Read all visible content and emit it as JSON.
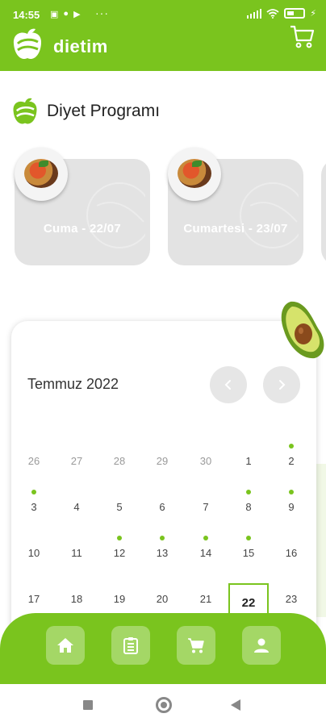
{
  "status_bar": {
    "time": "14:55",
    "icons": [
      "sim-icon",
      "whatsapp-icon",
      "play-icon",
      "more-dots"
    ],
    "battery_icon": "battery-icon",
    "wifi_icon": "wifi-icon",
    "signal_icon": "signal-icon"
  },
  "app_bar": {
    "brand": "dietim",
    "logo_icon": "apple-logo-icon",
    "cart_icon": "cart-icon"
  },
  "section": {
    "title": "Diyet Programı",
    "icon": "apple-logo-icon"
  },
  "day_cards": [
    {
      "label": "Cuma - 22/07",
      "image": "food-plate"
    },
    {
      "label": "Cumartesi - 23/07",
      "image": "food-plate"
    }
  ],
  "calendar": {
    "month_label": "Temmuz 2022",
    "prev_icon": "chevron-left-icon",
    "next_icon": "chevron-right-icon",
    "weeks": [
      [
        {
          "day": "26",
          "muted": true,
          "dot": false
        },
        {
          "day": "27",
          "muted": true,
          "dot": false
        },
        {
          "day": "28",
          "muted": true,
          "dot": false
        },
        {
          "day": "29",
          "muted": true,
          "dot": false
        },
        {
          "day": "30",
          "muted": true,
          "dot": false
        },
        {
          "day": "1",
          "muted": false,
          "dot": false
        },
        {
          "day": "2",
          "muted": false,
          "dot": true
        }
      ],
      [
        {
          "day": "3",
          "muted": false,
          "dot": true
        },
        {
          "day": "4",
          "muted": false,
          "dot": false
        },
        {
          "day": "5",
          "muted": false,
          "dot": false
        },
        {
          "day": "6",
          "muted": false,
          "dot": false
        },
        {
          "day": "7",
          "muted": false,
          "dot": false
        },
        {
          "day": "8",
          "muted": false,
          "dot": true
        },
        {
          "day": "9",
          "muted": false,
          "dot": true
        }
      ],
      [
        {
          "day": "10",
          "muted": false,
          "dot": false
        },
        {
          "day": "11",
          "muted": false,
          "dot": false
        },
        {
          "day": "12",
          "muted": false,
          "dot": true
        },
        {
          "day": "13",
          "muted": false,
          "dot": true
        },
        {
          "day": "14",
          "muted": false,
          "dot": true
        },
        {
          "day": "15",
          "muted": false,
          "dot": true
        },
        {
          "day": "16",
          "muted": false,
          "dot": false
        }
      ],
      [
        {
          "day": "17",
          "muted": false,
          "dot": false
        },
        {
          "day": "18",
          "muted": false,
          "dot": false
        },
        {
          "day": "19",
          "muted": false,
          "dot": false
        },
        {
          "day": "20",
          "muted": false,
          "dot": false
        },
        {
          "day": "21",
          "muted": false,
          "dot": false
        },
        {
          "day": "22",
          "muted": false,
          "dot": false,
          "today": true
        },
        {
          "day": "23",
          "muted": false,
          "dot": false
        }
      ]
    ]
  },
  "bottom_nav": [
    {
      "name": "home",
      "icon": "home-icon"
    },
    {
      "name": "program",
      "icon": "clipboard-icon"
    },
    {
      "name": "cart",
      "icon": "cart-icon"
    },
    {
      "name": "profile",
      "icon": "user-icon"
    }
  ],
  "system_nav": [
    "recents-icon",
    "home-circle-icon",
    "back-icon"
  ],
  "colors": {
    "brand_green": "#7ac41e",
    "card_grey": "#e3e3e3",
    "muted_text": "#9a9a9a"
  }
}
